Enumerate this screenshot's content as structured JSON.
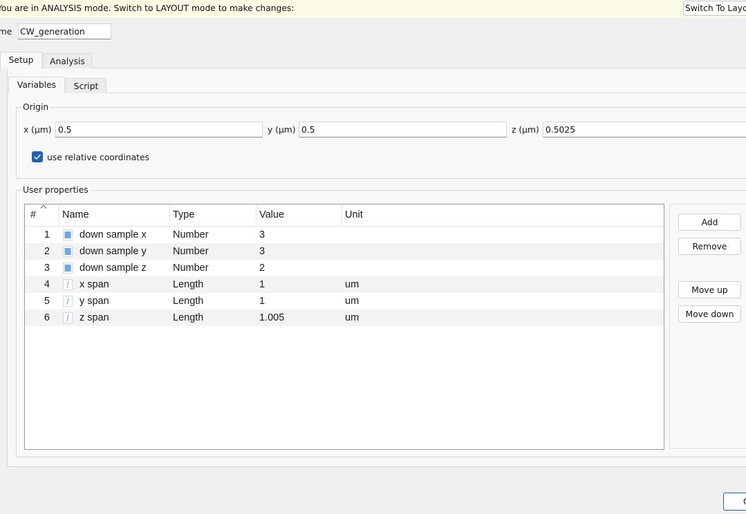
{
  "banner": {
    "message": "You are in ANALYSIS mode.  Switch to LAYOUT mode to make changes:",
    "switch_button": "Switch To Layout"
  },
  "name_field": {
    "label": "Name",
    "value": "CW_generation"
  },
  "tabs": {
    "setup": "Setup",
    "analysis": "Analysis"
  },
  "subtabs": {
    "variables": "Variables",
    "script": "Script"
  },
  "origin": {
    "title": "Origin",
    "x_label": "x (μm)",
    "x_value": "0.5",
    "y_label": "y (μm)",
    "y_value": "0.5",
    "z_label": "z (μm)",
    "z_value": "0.5025",
    "relative_label": "use relative coordinates",
    "relative_checked": true
  },
  "user_properties": {
    "title": "User properties",
    "columns": [
      "#",
      "Name",
      "Type",
      "Value",
      "Unit"
    ],
    "rows": [
      {
        "num": "1",
        "icon": "number-icon",
        "name": "down sample x",
        "type": "Number",
        "value": "3",
        "unit": ""
      },
      {
        "num": "2",
        "icon": "number-icon",
        "name": "down sample y",
        "type": "Number",
        "value": "3",
        "unit": ""
      },
      {
        "num": "3",
        "icon": "number-icon",
        "name": "down sample z",
        "type": "Number",
        "value": "2",
        "unit": ""
      },
      {
        "num": "4",
        "icon": "length-icon",
        "name": "x span",
        "type": "Length",
        "value": "1",
        "unit": "um"
      },
      {
        "num": "5",
        "icon": "length-icon",
        "name": "y span",
        "type": "Length",
        "value": "1",
        "unit": "um"
      },
      {
        "num": "6",
        "icon": "length-icon",
        "name": "z span",
        "type": "Length",
        "value": "1.005",
        "unit": "um"
      }
    ]
  },
  "buttons": {
    "add": "Add",
    "remove": "Remove",
    "move_up": "Move up",
    "move_down": "Move down",
    "ok": "OK"
  },
  "colors": {
    "banner_bg": "#fbfbe6",
    "accent": "#1f5fb5",
    "number_icon": "#6fa6e8"
  }
}
